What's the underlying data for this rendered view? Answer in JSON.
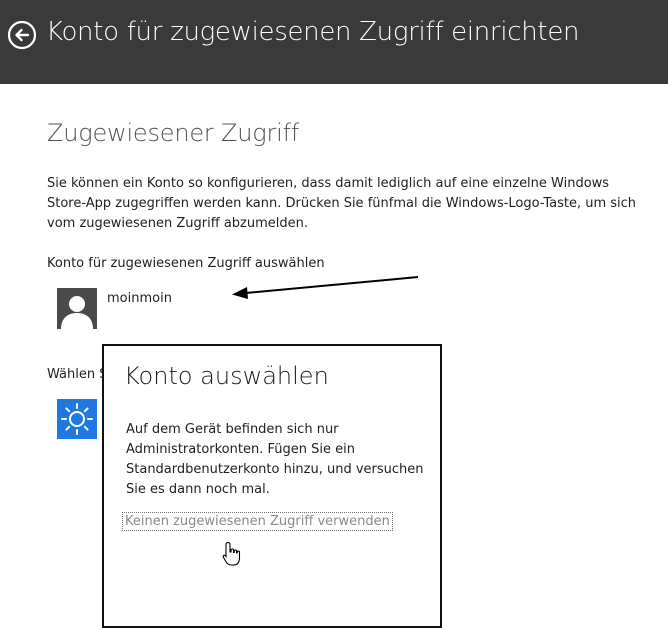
{
  "header": {
    "title": "Konto für zugewiesenen Zugriff einrichten",
    "back_icon": "back-arrow-icon"
  },
  "main": {
    "section_title": "Zugewiesener Zugriff",
    "description": "Sie können ein Konto so konfigurieren, dass damit lediglich auf eine einzelne Windows Store-App zugegriffen werden kann. Drücken Sie fünfmal die Windows-Logo-Taste, um sich vom zugewiesenen Zugriff abzumelden.",
    "account_label": "Konto für zugewiesenen Zugriff auswählen",
    "account_name": "moinmoin",
    "app_label_visible": "Wählen S",
    "app_tile_color": "#1f79e0"
  },
  "dialog": {
    "title": "Konto auswählen",
    "body": "Auf dem Gerät befinden sich nur Administratorkonten. Fügen Sie ein Standardbenutzerkonto hinzu, und versuchen Sie es dann noch mal.",
    "link": "Keinen zugewiesenen Zugriff verwenden"
  },
  "colors": {
    "header_bg": "#3a3a3a",
    "accent": "#1f79e0"
  }
}
